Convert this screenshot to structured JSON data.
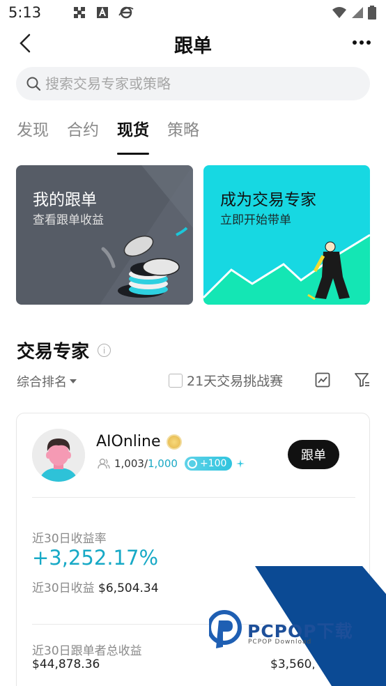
{
  "status_bar": {
    "time": "5:13"
  },
  "header": {
    "title": "跟单"
  },
  "search": {
    "placeholder": "搜索交易专家或策略"
  },
  "tabs": [
    {
      "label": "发现",
      "active": false
    },
    {
      "label": "合约",
      "active": false
    },
    {
      "label": "现货",
      "active": true
    },
    {
      "label": "策略",
      "active": false
    }
  ],
  "banners": {
    "left": {
      "title": "我的跟单",
      "subtitle": "查看跟单收益",
      "color": "#565c66"
    },
    "right": {
      "title": "成为交易专家",
      "subtitle": "立即开始带单",
      "color": "#17d8e2"
    }
  },
  "section": {
    "title": "交易专家"
  },
  "filters": {
    "sort_label": "综合排名",
    "challenge_label": "21天交易挑战赛"
  },
  "trader": {
    "name": "AIOnline",
    "followers": "1,003/",
    "followers_cap": "1,000",
    "boost": "+100",
    "follow_label": "跟单",
    "pnl_rate_label": "近30日收益率",
    "pnl_rate": "+3,252.17%",
    "pnl_label": "近30日收益",
    "pnl_value": "$6,504.34",
    "follower_pnl_label": "近30日跟单者总收益",
    "follower_pnl_value": "$44,878.36",
    "aum_value": "$3,560,65"
  },
  "watermark": {
    "brand": "PCPOP下载",
    "sub": "PCPOP Download"
  },
  "colors": {
    "accent": "#17a9c6",
    "primary_button": "#111111"
  }
}
